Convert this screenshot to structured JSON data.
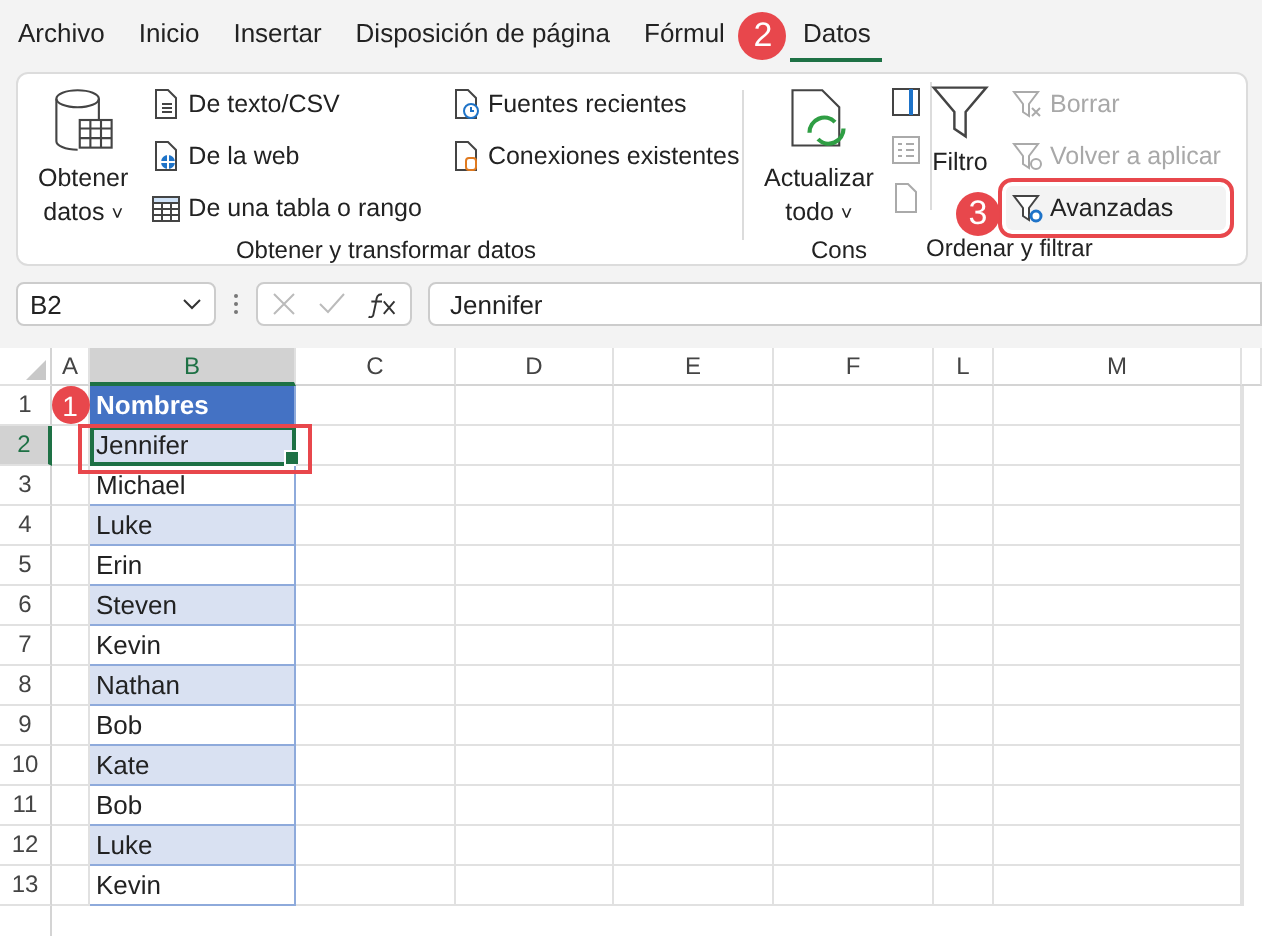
{
  "tabs": [
    {
      "label": "Archivo",
      "selected": false
    },
    {
      "label": "Inicio",
      "selected": false
    },
    {
      "label": "Insertar",
      "selected": false
    },
    {
      "label": "Disposición de página",
      "selected": false
    },
    {
      "label": "Fórmul",
      "selected": false
    },
    {
      "label": "Datos",
      "selected": true
    }
  ],
  "ribbon": {
    "get_data": {
      "label": "Obtener",
      "label_2": "datos",
      "caret": "˅"
    },
    "group_1_items": [
      {
        "label": "De texto/CSV",
        "kind": "text"
      },
      {
        "label": "De la web",
        "kind": "web"
      },
      {
        "label": "De una tabla o rango",
        "kind": "table"
      },
      {
        "label": "Fuentes recientes",
        "kind": "recent"
      },
      {
        "label": "Conexiones existentes",
        "kind": "connections"
      }
    ],
    "group_1_label": "Obtener y transformar datos",
    "refresh": {
      "label": "Actualizar",
      "label_2": "todo",
      "caret": "˅"
    },
    "group_2_label": "Cons",
    "filter": {
      "label": "Filtro"
    },
    "filter_items": [
      {
        "label": "Borrar",
        "kind": "clear",
        "disabled": true,
        "highlighted": false
      },
      {
        "label": "Volver a aplicar",
        "kind": "reapply",
        "disabled": true,
        "highlighted": false
      },
      {
        "label": "Avanzadas",
        "kind": "advanced",
        "disabled": false,
        "highlighted": true
      }
    ],
    "group_3_label": "Ordenar y filtrar"
  },
  "formula_bar": {
    "name_box": "B2",
    "value": "Jennifer"
  },
  "columns": [
    {
      "label": "A",
      "selected": false
    },
    {
      "label": "B",
      "selected": true
    },
    {
      "label": "C",
      "selected": false
    },
    {
      "label": "D",
      "selected": false
    },
    {
      "label": "E",
      "selected": false
    },
    {
      "label": "F",
      "selected": false
    },
    {
      "label": "L",
      "selected": false
    },
    {
      "label": "M",
      "selected": false
    }
  ],
  "rows": [
    {
      "number": "1",
      "value": "Nombres",
      "kind": "header",
      "selected": false
    },
    {
      "number": "2",
      "value": "Jennifer",
      "kind": "data",
      "banded": true,
      "selected": true
    },
    {
      "number": "3",
      "value": "Michael",
      "kind": "data",
      "banded": false,
      "selected": false
    },
    {
      "number": "4",
      "value": "Luke",
      "kind": "data",
      "banded": true,
      "selected": false
    },
    {
      "number": "5",
      "value": "Erin",
      "kind": "data",
      "banded": false,
      "selected": false
    },
    {
      "number": "6",
      "value": "Steven",
      "kind": "data",
      "banded": true,
      "selected": false
    },
    {
      "number": "7",
      "value": "Kevin",
      "kind": "data",
      "banded": false,
      "selected": false
    },
    {
      "number": "8",
      "value": "Nathan",
      "kind": "data",
      "banded": true,
      "selected": false
    },
    {
      "number": "9",
      "value": "Bob",
      "kind": "data",
      "banded": false,
      "selected": false
    },
    {
      "number": "10",
      "value": "Kate",
      "kind": "data",
      "banded": true,
      "selected": false
    },
    {
      "number": "11",
      "value": "Bob",
      "kind": "data",
      "banded": false,
      "selected": false
    },
    {
      "number": "12",
      "value": "Luke",
      "kind": "data",
      "banded": true,
      "selected": false
    },
    {
      "number": "13",
      "value": "Kevin",
      "kind": "data",
      "banded": false,
      "selected": false
    }
  ],
  "annotations": [
    {
      "label": "1"
    },
    {
      "label": "2"
    },
    {
      "label": "3"
    }
  ]
}
